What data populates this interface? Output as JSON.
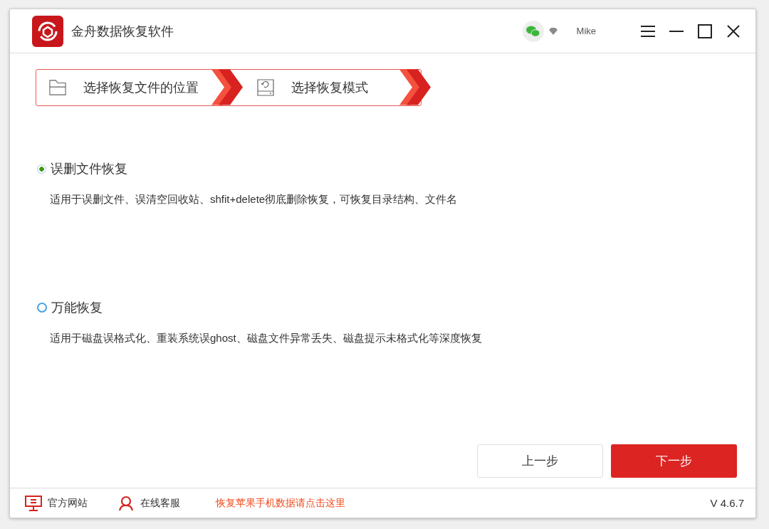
{
  "window": {
    "title": "金舟数据恢复软件",
    "user": "Mike"
  },
  "steps": [
    {
      "kind": "folder",
      "label": "选择恢复文件的位置"
    },
    {
      "kind": "disk",
      "label": "选择恢复模式"
    }
  ],
  "options": [
    {
      "title": "误删文件恢复",
      "description": "适用于误删文件、误清空回收站、shfit+delete彻底删除恢复，可恢复目录结构、文件名",
      "selected": true
    },
    {
      "title": "万能恢复",
      "description": "适用于磁盘误格式化、重装系统误ghost、磁盘文件异常丢失、磁盘提示未格式化等深度恢复",
      "selected": false
    }
  ],
  "buttons": {
    "previous": "上一步",
    "next": "下一步"
  },
  "footer": {
    "links": [
      {
        "kind": "monitor",
        "label": "官方网站"
      },
      {
        "kind": "person",
        "label": "在线客服"
      }
    ],
    "promo": "恢复苹果手机数据请点击这里",
    "version": "V 4.6.7"
  }
}
